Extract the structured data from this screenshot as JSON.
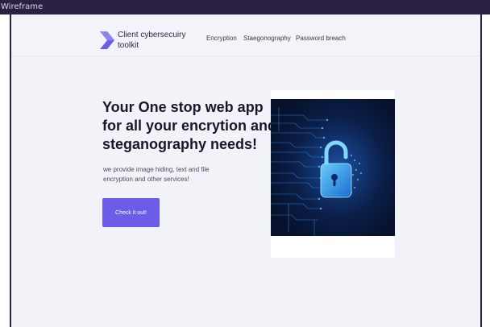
{
  "window": {
    "title": "Wireframe"
  },
  "header": {
    "brand": "Client cybersecuiry toolkit",
    "nav": [
      "Encryption",
      "Staegonography",
      "Password breach"
    ]
  },
  "hero": {
    "title": "Your One stop web app for all your encrytion and steganography needs!",
    "subtitle": "we provide image hiding, text and file encryption  and other services!",
    "cta_label": "Check it out!"
  },
  "icons": {
    "logo": "chevron-logo-icon",
    "illustration": "padlock-illustration"
  },
  "colors": {
    "accent": "#6b5de8",
    "background": "#f1f3f9",
    "frame": "#2a2142",
    "illustration_bg": "#0a1733"
  }
}
